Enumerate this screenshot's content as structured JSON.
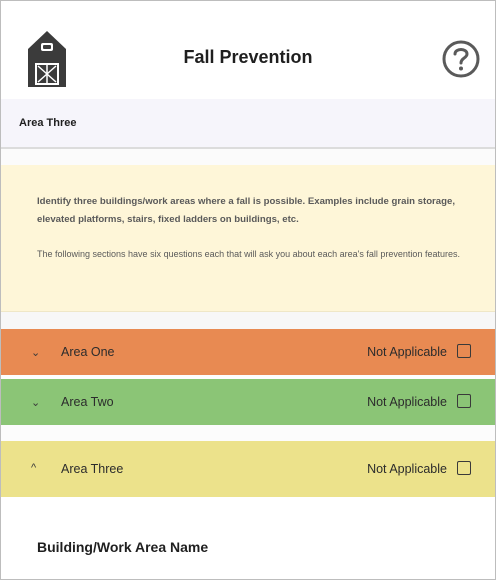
{
  "header": {
    "title": "Fall Prevention",
    "logo_icon": "barn-icon",
    "help_icon": "help-icon"
  },
  "subheader": {
    "title": "Area Three"
  },
  "info": {
    "paragraph1": "Identify three buildings/work areas where a fall is possible. Examples include grain storage, elevated platforms, stairs, fixed ladders on buildings, etc.",
    "paragraph2": "The following sections have six questions each that will ask you about each area's fall prevention features."
  },
  "sections": [
    {
      "label": "Area One",
      "not_applicable_label": "Not Applicable",
      "color": "#e88a52",
      "expanded": false,
      "chevron": "⌄"
    },
    {
      "label": "Area Two",
      "not_applicable_label": "Not Applicable",
      "color": "#8bc576",
      "expanded": false,
      "chevron": "⌄"
    },
    {
      "label": "Area Three",
      "not_applicable_label": "Not Applicable",
      "color": "#ece28b",
      "expanded": true,
      "chevron": "^"
    }
  ],
  "form": {
    "field_label": "Building/Work Area Name"
  }
}
